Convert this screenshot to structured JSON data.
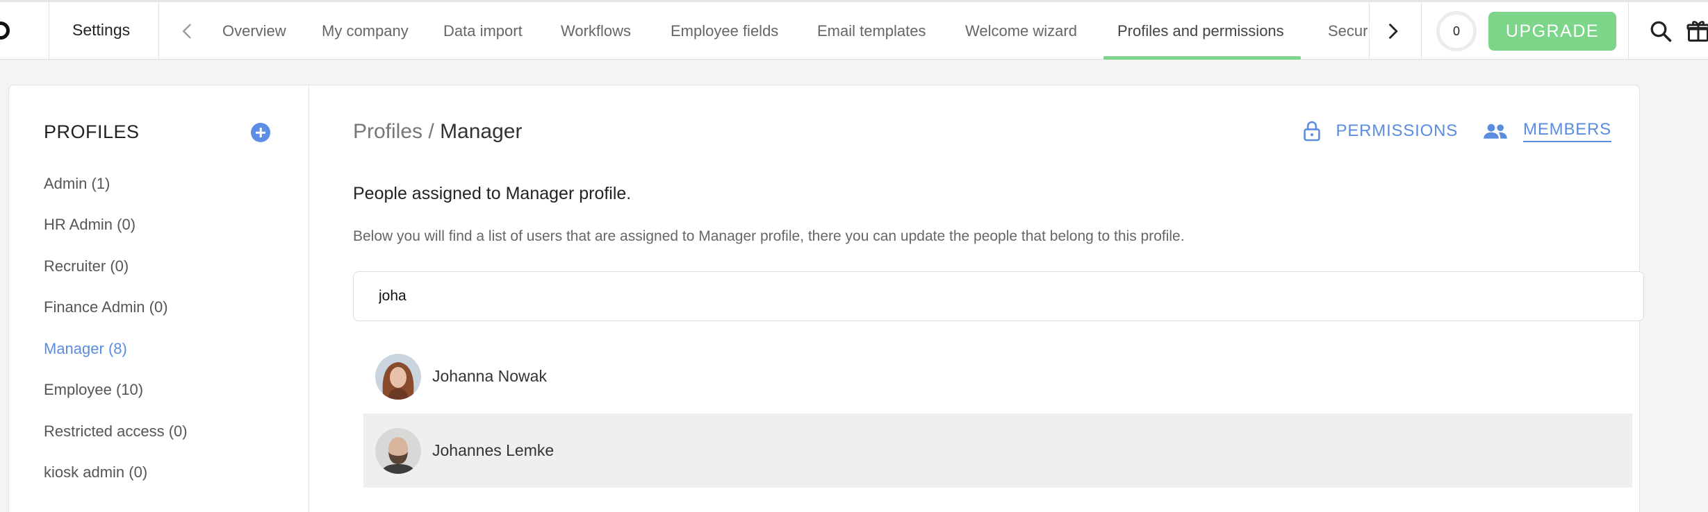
{
  "header": {
    "section_title": "Settings",
    "tabs": [
      {
        "label": "Overview"
      },
      {
        "label": "My company"
      },
      {
        "label": "Data import"
      },
      {
        "label": "Workflows"
      },
      {
        "label": "Employee fields"
      },
      {
        "label": "Email templates"
      },
      {
        "label": "Welcome wizard"
      },
      {
        "label": "Profiles and permissions",
        "active": true
      },
      {
        "label": "Security"
      }
    ],
    "notification_count": "0",
    "upgrade_label": "UPGRADE",
    "icons": [
      "chevron-left-icon",
      "chevron-right-icon",
      "search-icon",
      "gift-icon"
    ]
  },
  "sidebar": {
    "heading": "PROFILES",
    "add_icon": "plus-circle-icon",
    "items": [
      {
        "label": "Admin (1)"
      },
      {
        "label": "HR Admin (0)"
      },
      {
        "label": "Recruiter (0)"
      },
      {
        "label": "Finance Admin (0)"
      },
      {
        "label": "Manager (8)",
        "active": true
      },
      {
        "label": "Employee (10)"
      },
      {
        "label": "Restricted access (0)"
      },
      {
        "label": "kiosk admin (0)"
      }
    ]
  },
  "main": {
    "breadcrumb": {
      "root": "Profiles",
      "separator": " / ",
      "current": "Manager"
    },
    "actions": {
      "permissions_label": "PERMISSIONS",
      "members_label": "MEMBERS",
      "active": "members"
    },
    "title": "People assigned to Manager profile.",
    "description": "Below you will find a list of users that are assigned to Manager profile, there you can update the people that belong to this profile.",
    "search": {
      "value": "joha"
    },
    "results": [
      {
        "name": "Johanna Nowak"
      },
      {
        "name": "Johannes Lemke",
        "highlighted": true
      }
    ]
  },
  "colors": {
    "accent": "#5a8de0",
    "upgrade": "#7dd58a",
    "active_tab_underline": "#7bd58d",
    "highlight_row": "#efefef"
  }
}
